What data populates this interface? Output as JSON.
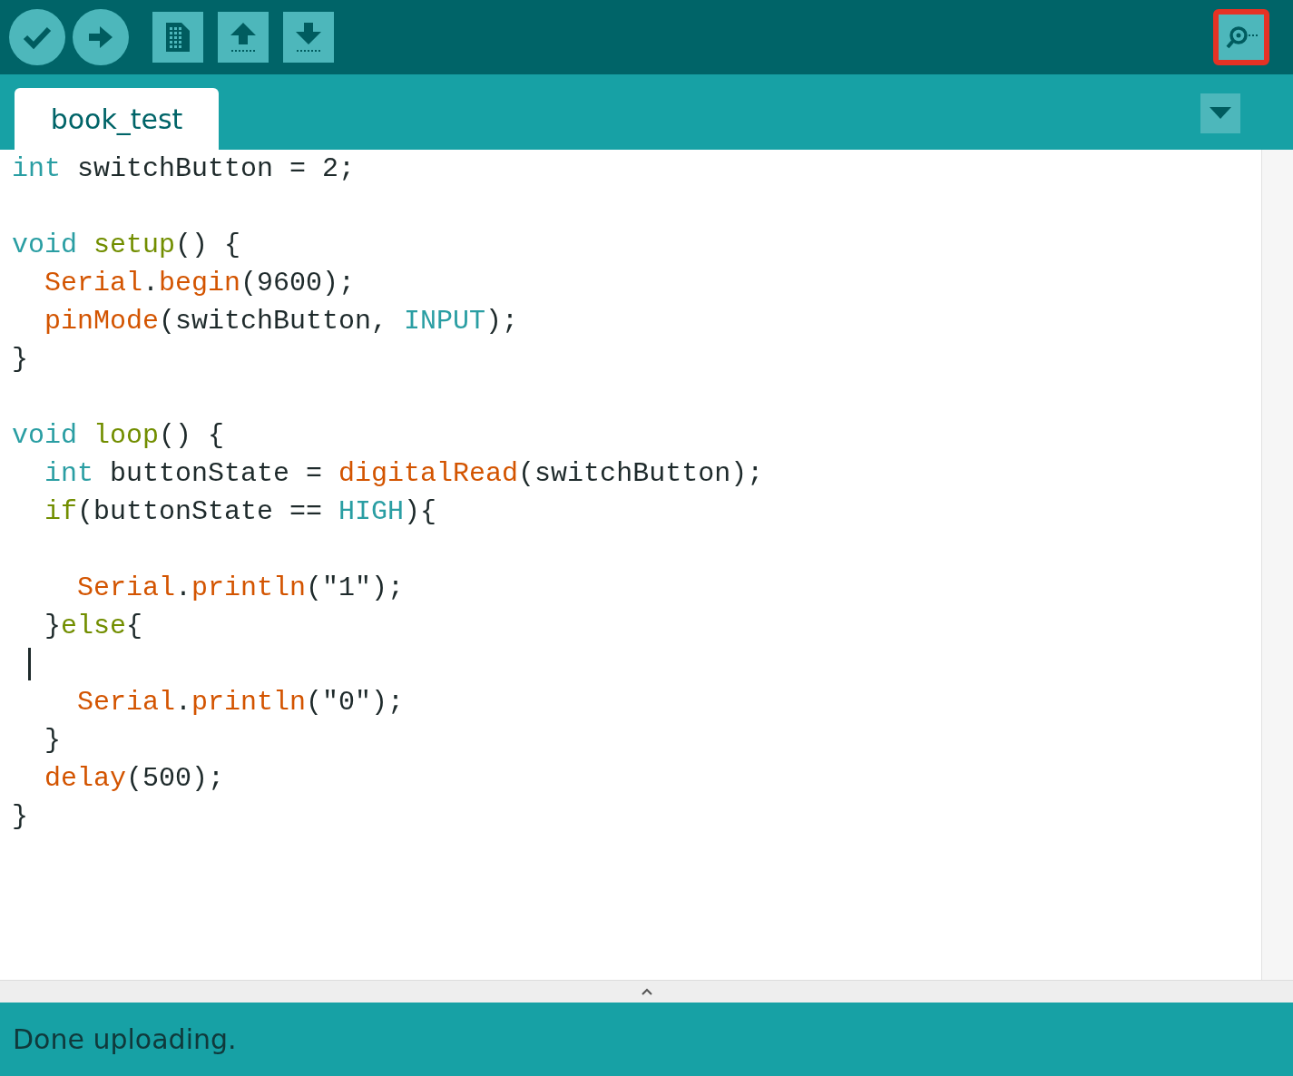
{
  "toolbar": {
    "serial_monitor": {
      "highlighted": true
    }
  },
  "tabs": [
    {
      "label": "book_test",
      "selected": true
    }
  ],
  "editor": {
    "lines": [
      {
        "kind": "code",
        "tokens": [
          {
            "text": "int",
            "kind": "keyword"
          },
          {
            "text": " switchButton = 2;",
            "kind": "plain"
          }
        ]
      },
      {
        "kind": "blank"
      },
      {
        "kind": "code",
        "tokens": [
          {
            "text": "void",
            "kind": "keyword"
          },
          {
            "text": " setup",
            "kind": "structure"
          },
          {
            "text": "() {",
            "kind": "plain"
          }
        ]
      },
      {
        "kind": "code",
        "tokens": [
          {
            "text": "  Serial",
            "kind": "function"
          },
          {
            "text": ".",
            "kind": "plain"
          },
          {
            "text": "begin",
            "kind": "function"
          },
          {
            "text": "(9600);",
            "kind": "plain"
          }
        ]
      },
      {
        "kind": "code",
        "tokens": [
          {
            "text": "  pinMode",
            "kind": "function"
          },
          {
            "text": "(switchButton, ",
            "kind": "plain"
          },
          {
            "text": "INPUT",
            "kind": "keyword"
          },
          {
            "text": ");",
            "kind": "plain"
          }
        ]
      },
      {
        "kind": "code",
        "tokens": [
          {
            "text": "}",
            "kind": "plain"
          }
        ]
      },
      {
        "kind": "blank"
      },
      {
        "kind": "code",
        "tokens": [
          {
            "text": "void",
            "kind": "keyword"
          },
          {
            "text": " loop",
            "kind": "structure"
          },
          {
            "text": "() {",
            "kind": "plain"
          }
        ]
      },
      {
        "kind": "code",
        "tokens": [
          {
            "text": "  int",
            "kind": "keyword"
          },
          {
            "text": " buttonState = ",
            "kind": "plain"
          },
          {
            "text": "digitalRead",
            "kind": "function"
          },
          {
            "text": "(switchButton);",
            "kind": "plain"
          }
        ]
      },
      {
        "kind": "code",
        "tokens": [
          {
            "text": "  if",
            "kind": "structure"
          },
          {
            "text": "(buttonState == ",
            "kind": "plain"
          },
          {
            "text": "HIGH",
            "kind": "keyword"
          },
          {
            "text": "){",
            "kind": "plain"
          }
        ]
      },
      {
        "kind": "blank"
      },
      {
        "kind": "code",
        "tokens": [
          {
            "text": "    Serial",
            "kind": "function"
          },
          {
            "text": ".",
            "kind": "plain"
          },
          {
            "text": "println",
            "kind": "function"
          },
          {
            "text": "(\"1\");",
            "kind": "plain"
          }
        ]
      },
      {
        "kind": "code",
        "tokens": [
          {
            "text": "  }",
            "kind": "plain"
          },
          {
            "text": "else",
            "kind": "structure"
          },
          {
            "text": "{",
            "kind": "plain"
          }
        ]
      },
      {
        "kind": "cursor"
      },
      {
        "kind": "code",
        "tokens": [
          {
            "text": "    Serial",
            "kind": "function"
          },
          {
            "text": ".",
            "kind": "plain"
          },
          {
            "text": "println",
            "kind": "function"
          },
          {
            "text": "(\"0\");",
            "kind": "plain"
          }
        ]
      },
      {
        "kind": "code",
        "tokens": [
          {
            "text": "  }",
            "kind": "plain"
          }
        ]
      },
      {
        "kind": "code",
        "tokens": [
          {
            "text": "  delay",
            "kind": "function"
          },
          {
            "text": "(500);",
            "kind": "plain"
          }
        ]
      },
      {
        "kind": "code",
        "tokens": [
          {
            "text": "}",
            "kind": "plain"
          }
        ]
      }
    ]
  },
  "status_bar": {
    "message": "Done uploading."
  }
}
